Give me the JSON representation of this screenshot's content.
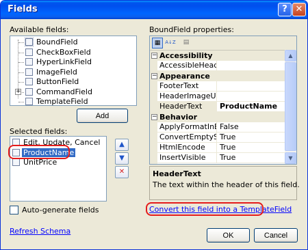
{
  "window": {
    "title": "Fields",
    "help_label": "?",
    "close_label": "✕"
  },
  "available_fields": {
    "label": "Available fields:",
    "items": [
      {
        "label": "BoundField",
        "icon": "boundfield-icon"
      },
      {
        "label": "CheckBoxField",
        "icon": "checkbox-field-icon"
      },
      {
        "label": "HyperLinkField",
        "icon": "hyperlink-field-icon"
      },
      {
        "label": "ImageField",
        "icon": "image-field-icon"
      },
      {
        "label": "ButtonField",
        "icon": "button-field-icon"
      },
      {
        "label": "CommandField",
        "icon": "command-field-icon",
        "expander": "+"
      },
      {
        "label": "TemplateField",
        "icon": "template-field-icon"
      }
    ]
  },
  "add_button": {
    "label": "Add"
  },
  "selected_fields": {
    "label": "Selected fields:",
    "items": [
      {
        "label": "Edit, Update, Cancel",
        "selected": false
      },
      {
        "label": "ProductName",
        "selected": true
      },
      {
        "label": "UnitPrice",
        "selected": false
      }
    ]
  },
  "move_up": {
    "icon": "up-arrow-icon",
    "glyph": "▲"
  },
  "move_down": {
    "icon": "down-arrow-icon",
    "glyph": "▼"
  },
  "delete": {
    "icon": "delete-x-icon",
    "glyph": "✕"
  },
  "auto_generate": {
    "label": "Auto-generate fields",
    "checked": false
  },
  "refresh_schema": {
    "label": "Refresh Schema"
  },
  "properties": {
    "label": "BoundField properties:",
    "toolbar": {
      "categorized": {
        "icon": "categorized-icon",
        "glyph": "▦",
        "active": true
      },
      "alphabetical": {
        "icon": "alphabetical-sort-icon",
        "glyph": "A↓Z",
        "active": false
      },
      "pages": {
        "icon": "property-pages-icon",
        "glyph": "▤",
        "active": false
      }
    },
    "rows": [
      {
        "kind": "category",
        "name": "Accessibility"
      },
      {
        "kind": "prop",
        "name": "AccessibleHeaderTe",
        "value": ""
      },
      {
        "kind": "category",
        "name": "Appearance"
      },
      {
        "kind": "prop",
        "name": "FooterText",
        "value": ""
      },
      {
        "kind": "prop",
        "name": "HeaderImageUrl",
        "value": ""
      },
      {
        "kind": "prop",
        "name": "HeaderText",
        "value": "ProductName",
        "selected": true
      },
      {
        "kind": "category",
        "name": "Behavior"
      },
      {
        "kind": "prop",
        "name": "ApplyFormatInEditM",
        "value": "False"
      },
      {
        "kind": "prop",
        "name": "ConvertEmptyString",
        "value": "True"
      },
      {
        "kind": "prop",
        "name": "HtmlEncode",
        "value": "True"
      },
      {
        "kind": "prop",
        "name": "InsertVisible",
        "value": "True"
      }
    ],
    "description": {
      "title": "HeaderText",
      "text": "The text within the header of this field."
    }
  },
  "convert_link": {
    "label": "Convert this field into a TemplateField"
  },
  "ok_button": {
    "label": "OK"
  },
  "cancel_button": {
    "label": "Cancel"
  },
  "colors": {
    "selection": "#316ac5",
    "annotation_ring": "#e41b1b",
    "link": "#0000ff"
  }
}
